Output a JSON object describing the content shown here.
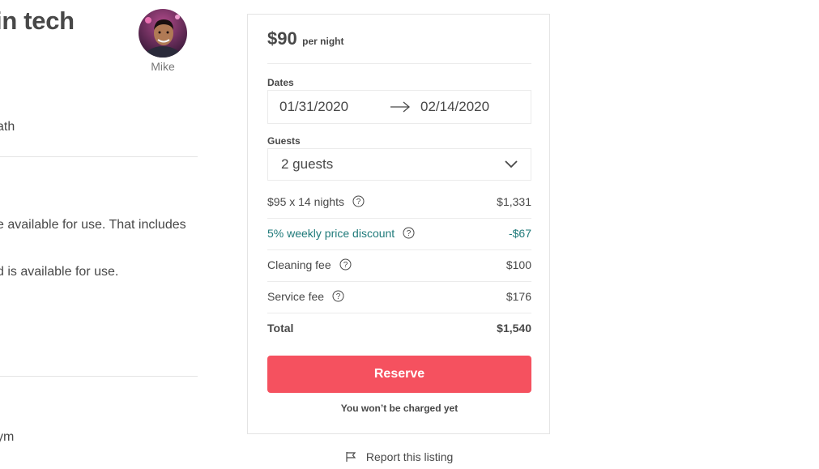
{
  "listing": {
    "title_fragment": "in tech",
    "host_name": "Mike",
    "text_lines": [
      "ath",
      "e available for use. That includes",
      "d is available for use.",
      "ym"
    ]
  },
  "booking": {
    "price": "$90",
    "price_unit": "per night",
    "dates_label": "Dates",
    "check_in": "01/31/2020",
    "check_out": "02/14/2020",
    "guests_label": "Guests",
    "guests_value": "2 guests",
    "fees": {
      "nights": {
        "label": "$95 x 14 nights",
        "value": "$1,331"
      },
      "discount": {
        "label": "5% weekly price discount",
        "value": "-$67"
      },
      "cleaning": {
        "label": "Cleaning fee",
        "value": "$100"
      },
      "service": {
        "label": "Service fee",
        "value": "$176"
      },
      "total": {
        "label": "Total",
        "value": "$1,540"
      }
    },
    "reserve_label": "Reserve",
    "not_charged_text": "You won’t be charged yet"
  },
  "footer": {
    "report_label": "Report this listing"
  },
  "colors": {
    "reserve_button": "#f5515f",
    "discount_text": "#1f7a7a",
    "text": "#484848",
    "border": "#e4e4e4"
  },
  "icons": [
    "arrow-right-icon",
    "chevron-down-icon",
    "question-icon",
    "flag-icon"
  ]
}
